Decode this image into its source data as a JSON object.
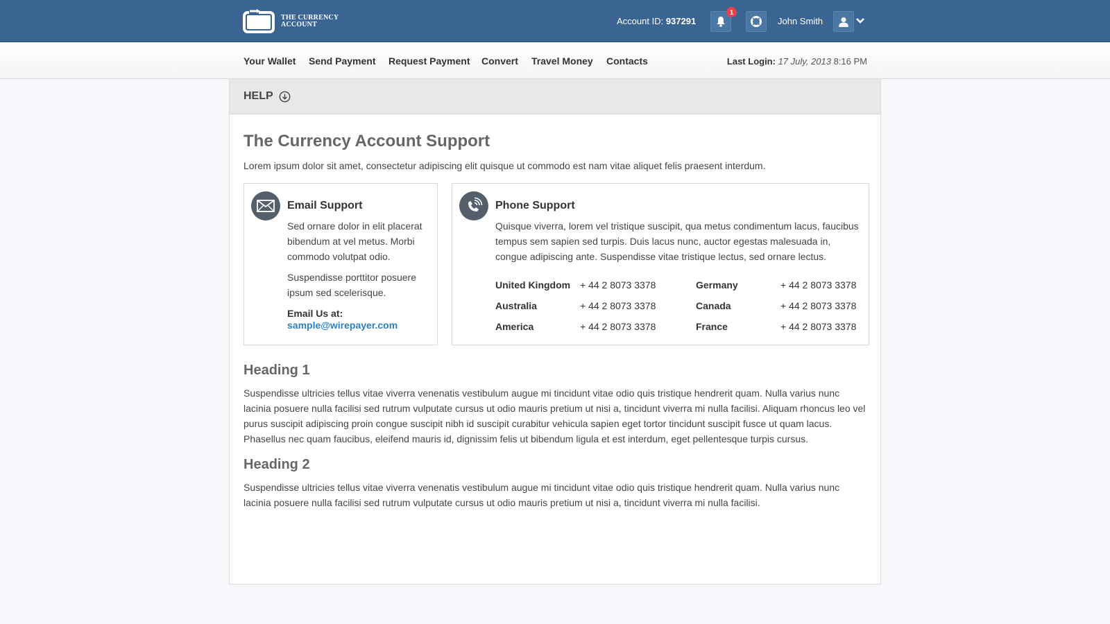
{
  "header": {
    "logo_text_line1": "THE CURRENCY",
    "logo_text_line2": "ACCOUNT",
    "account_label": "Account ID:",
    "account_id": "937291",
    "notification_count": "1",
    "user_name": "John Smith",
    "icons": [
      "bell-icon",
      "lifebuoy-icon",
      "user-icon",
      "chevron-down-icon"
    ]
  },
  "nav": {
    "items": [
      "Your Wallet",
      "Send Payment",
      "Request Payment",
      "Convert",
      "Travel Money",
      "Contacts"
    ],
    "last_login_label": "Last Login:",
    "last_login_date": "17 July, 2013",
    "last_login_time": "8:16 PM"
  },
  "help": {
    "label": "HELP"
  },
  "main": {
    "title": "The Currency Account Support",
    "intro": "Lorem ipsum dolor sit amet, consectetur adipiscing elit quisque ut commodo est nam vitae aliquet felis praesent interdum."
  },
  "email_support": {
    "title": "Email Support",
    "para1": "Sed ornare dolor in elit placerat bibendum at vel metus. Morbi commodo volutpat odio.",
    "para2": "Suspendisse porttitor posuere ipsum sed scelerisque.",
    "email_label": "Email Us at:",
    "email": "sample@wirepayer.com"
  },
  "phone_support": {
    "title": "Phone Support",
    "text": "Quisque viverra, lorem vel tristique suscipit, qua metus condimentum lacus, faucibus tempus sem sapien sed turpis. Duis lacus nunc, auctor egestas malesuada in, congue adipiscing ante. Suspendisse vitae tristique lectus, sed ornare lectus.",
    "rows": [
      {
        "c1": "United Kingdom",
        "p1": "+ 44 2 8073 3378",
        "c2": "Germany",
        "p2": "+ 44 2 8073 3378"
      },
      {
        "c1": "Australia",
        "p1": "+ 44 2 8073 3378",
        "c2": "Canada",
        "p2": "+ 44 2 8073 3378"
      },
      {
        "c1": "America",
        "p1": "+ 44 2 8073 3378",
        "c2": "France",
        "p2": "+ 44 2 8073 3378"
      }
    ]
  },
  "sections": [
    {
      "heading": "Heading 1",
      "text": "Suspendisse ultricies tellus vitae viverra venenatis vestibulum augue mi tincidunt vitae odio quis tristique hendrerit quam. Nulla varius nunc  lacinia posuere nulla facilisi sed rutrum vulputate cursus ut odio mauris pretium ut nisi a, tincidunt viverra mi nulla facilisi. Aliquam rhoncus leo vel purus suscipit adipiscing proin congue suscipit nibh id suscipit curabitur vehicula sapien eget tortor tincidunt suscipit fusce ut quam lacus. Phasellus nec quam faucibus, eleifend mauris id, dignissim felis ut bibendum ligula et est interdum, eget pellentesque turpis cursus."
    },
    {
      "heading": "Heading 2",
      "text": "Suspendisse ultricies tellus vitae viverra venenatis vestibulum augue mi tincidunt vitae odio quis tristique hendrerit quam. Nulla varius nunc  lacinia posuere nulla facilisi sed rutrum vulputate cursus ut odio mauris pretium ut nisi a, tincidunt viverra mi nulla facilisi."
    }
  ],
  "colors": {
    "header_bg": "#3a6592",
    "link": "#2d7fc1",
    "badge": "#e5434a",
    "icon_circle": "#555f6a"
  }
}
